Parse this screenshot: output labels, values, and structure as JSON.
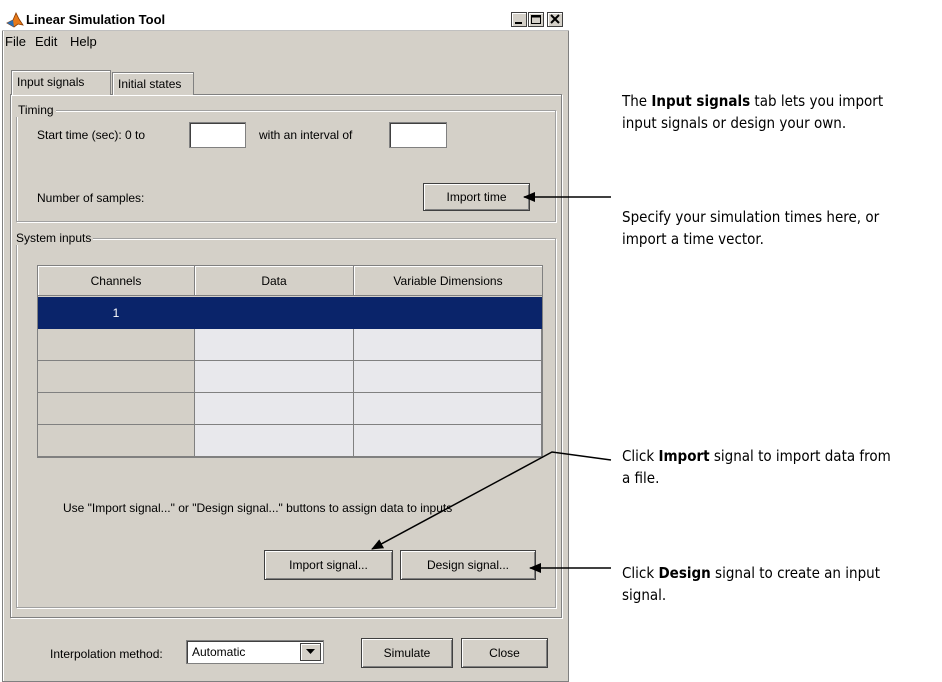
{
  "window": {
    "title": "Linear Simulation Tool",
    "controls": {
      "minimize": "minimize",
      "maximize": "maximize",
      "close": "close"
    }
  },
  "menubar": {
    "items": [
      "File",
      "Edit",
      "Help"
    ]
  },
  "tabs": [
    {
      "label": "Input signals",
      "active": true
    },
    {
      "label": "Initial states",
      "active": false
    }
  ],
  "timing": {
    "group_label": "Timing",
    "start_time_label": "Start time (sec): 0   to",
    "end_time_value": "",
    "interval_label": "with an interval of",
    "interval_value": "",
    "samples_label": "Number of samples:",
    "import_time_label": "Import time"
  },
  "system_inputs": {
    "group_label": "System inputs",
    "columns": [
      "Channels",
      "Data",
      "Variable Dimensions"
    ],
    "rows": [
      {
        "channel": "1",
        "data": "",
        "dims": "",
        "selected": true
      },
      {
        "channel": "",
        "data": "",
        "dims": "",
        "selected": false
      },
      {
        "channel": "",
        "data": "",
        "dims": "",
        "selected": false
      },
      {
        "channel": "",
        "data": "",
        "dims": "",
        "selected": false
      },
      {
        "channel": "",
        "data": "",
        "dims": "",
        "selected": false
      }
    ],
    "hint": "Use \"Import signal...\" or \"Design signal...\" buttons to assign data to inputs",
    "import_signal_label": "Import signal...",
    "design_signal_label": "Design signal..."
  },
  "footer": {
    "interpolation_label": "Interpolation method:",
    "interpolation_value": "Automatic",
    "simulate_label": "Simulate",
    "close_label": "Close"
  },
  "annotations": {
    "tab_note": {
      "text": "The Input signals tab lets you import\ninput signals or design your own.",
      "bold": [
        "Input signals"
      ]
    },
    "time_note": {
      "text": "Specify your simulation times here, or\nimport a time vector.",
      "bold": []
    },
    "import_note": {
      "text": "Click Import signal to import data from\na file.",
      "bold": [
        "Import"
      ]
    },
    "design_note": {
      "text": "Click Design signal to create an input\nsignal.",
      "bold": [
        "Design"
      ]
    }
  },
  "colors": {
    "window_bg": "#d4d0c8",
    "selection": "#0a246a",
    "cell_empty": "#e8e8ec"
  }
}
